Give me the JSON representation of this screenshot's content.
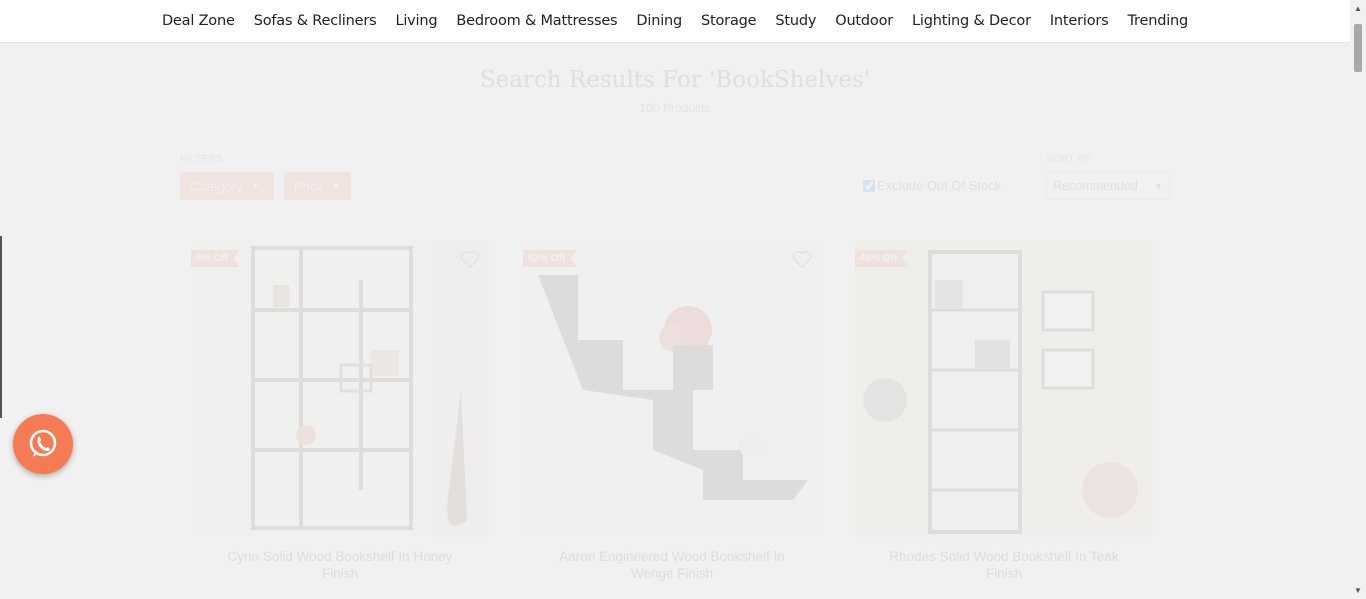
{
  "nav": {
    "items": [
      "Deal Zone",
      "Sofas & Recliners",
      "Living",
      "Bedroom & Mattresses",
      "Dining",
      "Storage",
      "Study",
      "Outdoor",
      "Lighting & Decor",
      "Interiors",
      "Trending"
    ]
  },
  "search": {
    "title": "Search Results For 'BookShelves'",
    "count": "100 Products"
  },
  "filters": {
    "label": "FILTERS",
    "category": "Category",
    "price": "Price"
  },
  "exclude": {
    "label": "Exclude Out Of Stock",
    "checked": true
  },
  "sort": {
    "label": "SORT BY",
    "value": "Recommended"
  },
  "products": [
    {
      "badge": "5% Off",
      "title": "Cyno Solid Wood Bookshelf In Honey Finish"
    },
    {
      "badge": "62% Off",
      "title": "Aaron Engineered Wood Bookshelf In Wenge Finish"
    },
    {
      "badge": "45% Off",
      "title": "Rhodes Solid Wood Bookshelf In Teak Finish"
    }
  ],
  "colors": {
    "accent": "#ef7350",
    "badge": "#e9633d",
    "whatsapp": "#f47b53"
  },
  "icons": {
    "whatsapp": "whatsapp-icon",
    "wishlist": "heart-icon"
  }
}
